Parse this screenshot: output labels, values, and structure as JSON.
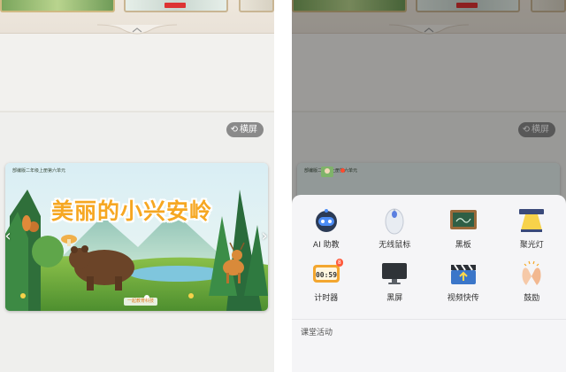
{
  "left_screen": {
    "landscape_button": {
      "icon": "rotate-icon",
      "label": "横屏"
    },
    "slide": {
      "caption": "部编版二年级上册第六单元",
      "title": "美丽的小兴安岭",
      "logo_text": "一起教育科技",
      "nav_prev": "‹",
      "nav_next": "›"
    }
  },
  "right_screen": {
    "landscape_button": {
      "icon": "rotate-icon",
      "label": "横屏"
    },
    "slide": {
      "caption": "部编版二年级上册第六单元"
    },
    "tools": [
      {
        "name": "ai-assistant",
        "label": "AI 助教",
        "icon": "robot-icon"
      },
      {
        "name": "wireless-mouse",
        "label": "无线鼠标",
        "icon": "mouse-icon"
      },
      {
        "name": "blackboard",
        "label": "黑板",
        "icon": "blackboard-icon"
      },
      {
        "name": "spotlight",
        "label": "聚光灯",
        "icon": "spotlight-icon"
      },
      {
        "name": "timer",
        "label": "计时器",
        "icon": "timer-icon",
        "display": "00:59",
        "badge": "8"
      },
      {
        "name": "black-screen",
        "label": "黑屏",
        "icon": "monitor-icon"
      },
      {
        "name": "video-quick-send",
        "label": "视频快传",
        "icon": "clapper-icon"
      },
      {
        "name": "encourage",
        "label": "鼓励",
        "icon": "clap-icon"
      }
    ],
    "section_title": "课堂活动"
  },
  "colors": {
    "title_orange": "#f6a722",
    "badge_red": "#ff5a3c",
    "panel_bg": "#f5f5f7"
  }
}
